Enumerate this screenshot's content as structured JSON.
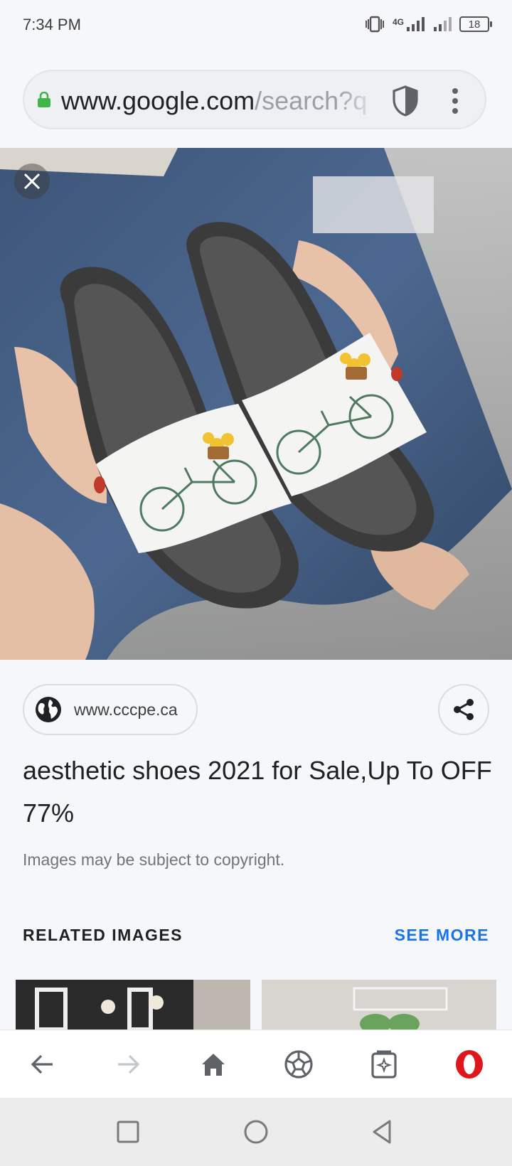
{
  "status_bar": {
    "time": "7:34 PM",
    "network": "4G",
    "battery": "18",
    "icons": [
      "vibrate-icon",
      "signal-4g-icon",
      "signal-icon",
      "battery-icon"
    ]
  },
  "browser": {
    "url_host": "www.google.com",
    "url_path": "/search?q",
    "icons": [
      "lock-icon",
      "shield-icon",
      "more-vert-icon"
    ]
  },
  "image_viewer": {
    "close_icon": "close-icon",
    "source": "www.cccpe.ca",
    "title": "aesthetic shoes 2021 for Sale,Up To OFF 77%",
    "copyright_note": "Images may be subject to copyright."
  },
  "related": {
    "header": "RELATED IMAGES",
    "see_more": "SEE MORE"
  },
  "toolbar": {
    "items": [
      "back-icon",
      "forward-icon",
      "home-icon",
      "speed-dial-icon",
      "tabs-icon",
      "opera-menu-icon"
    ]
  },
  "colors": {
    "accent": "#1a73e8",
    "opera_red": "#e0161c",
    "lock_green": "#3fb649"
  }
}
